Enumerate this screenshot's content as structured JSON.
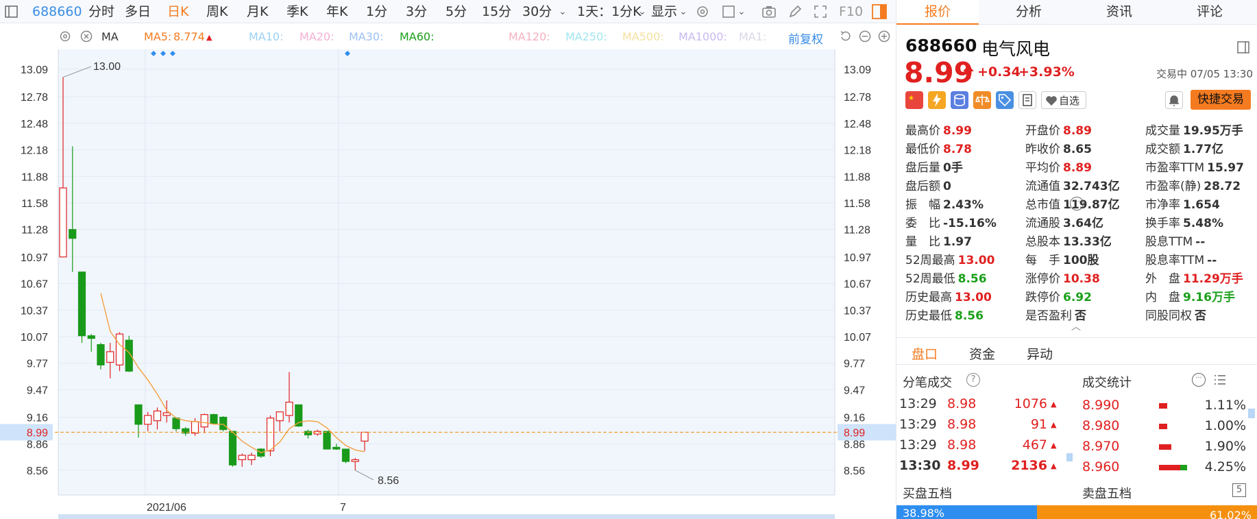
{
  "toolbar": {
    "code": "688660",
    "items": [
      "分时",
      "多日",
      "日K",
      "周K",
      "月K",
      "季K",
      "年K",
      "1分",
      "3分",
      "5分",
      "15分",
      "30分"
    ],
    "selected": "日K",
    "overlay": "1天：1分K",
    "display": "显示",
    "f10": "F10"
  },
  "indicators": {
    "ma": "MA",
    "ma5_label": "MA5:",
    "ma5_value": "8.774",
    "ma10": "MA10:",
    "ma20": "MA20:",
    "ma30": "MA30:",
    "ma60": "MA60:",
    "ma120": "MA120:",
    "ma250": "MA250:",
    "ma500": "MA500:",
    "ma1000": "MA1000:",
    "ma1": "MA1:",
    "adjust": "前复权"
  },
  "chart_data": {
    "type": "candlestick",
    "y_ticks": [
      "13.09",
      "12.78",
      "12.48",
      "12.18",
      "11.88",
      "11.58",
      "11.28",
      "10.97",
      "10.67",
      "10.37",
      "10.07",
      "9.77",
      "9.47",
      "9.16",
      "8.86",
      "8.56"
    ],
    "x_labels": [
      "2021/06",
      "7"
    ],
    "current_price": "8.99",
    "max_label": "13.00",
    "min_label": "8.56",
    "ylim": [
      8.42,
      13.15
    ],
    "candles": [
      {
        "o": 10.97,
        "h": 13.0,
        "l": 10.97,
        "c": 11.75
      },
      {
        "o": 11.28,
        "h": 12.22,
        "l": 10.8,
        "c": 11.18
      },
      {
        "o": 10.8,
        "h": 10.8,
        "l": 10.0,
        "c": 10.08
      },
      {
        "o": 10.08,
        "h": 10.1,
        "l": 9.9,
        "c": 10.05
      },
      {
        "o": 9.98,
        "h": 10.0,
        "l": 9.7,
        "c": 9.75
      },
      {
        "o": 9.78,
        "h": 10.0,
        "l": 9.6,
        "c": 9.9
      },
      {
        "o": 9.75,
        "h": 10.12,
        "l": 9.68,
        "c": 10.1
      },
      {
        "o": 10.03,
        "h": 10.08,
        "l": 9.67,
        "c": 9.68
      },
      {
        "o": 9.3,
        "h": 9.3,
        "l": 8.93,
        "c": 9.08
      },
      {
        "o": 9.08,
        "h": 9.22,
        "l": 9.0,
        "c": 9.18
      },
      {
        "o": 9.12,
        "h": 9.27,
        "l": 9.02,
        "c": 9.23
      },
      {
        "o": 9.18,
        "h": 9.35,
        "l": 9.1,
        "c": 9.21
      },
      {
        "o": 9.15,
        "h": 9.16,
        "l": 9.0,
        "c": 9.03
      },
      {
        "o": 9.03,
        "h": 9.05,
        "l": 8.95,
        "c": 8.98
      },
      {
        "o": 8.98,
        "h": 9.15,
        "l": 8.95,
        "c": 9.11
      },
      {
        "o": 9.05,
        "h": 9.2,
        "l": 8.98,
        "c": 9.19
      },
      {
        "o": 9.19,
        "h": 9.2,
        "l": 9.08,
        "c": 9.09
      },
      {
        "o": 9.16,
        "h": 9.17,
        "l": 9.0,
        "c": 9.02
      },
      {
        "o": 9.0,
        "h": 9.0,
        "l": 8.6,
        "c": 8.62
      },
      {
        "o": 8.68,
        "h": 8.75,
        "l": 8.6,
        "c": 8.73
      },
      {
        "o": 8.68,
        "h": 8.76,
        "l": 8.62,
        "c": 8.73
      },
      {
        "o": 8.8,
        "h": 8.81,
        "l": 8.7,
        "c": 8.72
      },
      {
        "o": 8.78,
        "h": 9.18,
        "l": 8.72,
        "c": 9.15
      },
      {
        "o": 9.12,
        "h": 9.22,
        "l": 9.0,
        "c": 9.22
      },
      {
        "o": 9.18,
        "h": 9.67,
        "l": 9.1,
        "c": 9.33
      },
      {
        "o": 9.3,
        "h": 9.3,
        "l": 9.05,
        "c": 9.06
      },
      {
        "o": 9.0,
        "h": 9.02,
        "l": 8.92,
        "c": 8.96
      },
      {
        "o": 8.97,
        "h": 9.02,
        "l": 8.95,
        "c": 9.0
      },
      {
        "o": 9.0,
        "h": 9.0,
        "l": 8.8,
        "c": 8.8
      },
      {
        "o": 8.82,
        "h": 8.86,
        "l": 8.79,
        "c": 8.8
      },
      {
        "o": 8.8,
        "h": 8.8,
        "l": 8.64,
        "c": 8.66
      },
      {
        "o": 8.66,
        "h": 8.7,
        "l": 8.56,
        "c": 8.68
      },
      {
        "o": 8.89,
        "h": 8.99,
        "l": 8.78,
        "c": 8.99
      }
    ],
    "ma5": [
      null,
      null,
      null,
      null,
      10.56,
      10.13,
      9.98,
      9.89,
      9.72,
      9.58,
      9.42,
      9.24,
      9.15,
      9.12,
      9.11,
      9.1,
      9.08,
      9.08,
      8.99,
      8.89,
      8.82,
      8.76,
      8.79,
      8.88,
      9.03,
      9.1,
      9.12,
      9.11,
      9.04,
      8.93,
      8.84,
      8.79,
      8.77
    ]
  },
  "panel": {
    "tabs": [
      "报价",
      "分析",
      "资讯",
      "评论"
    ],
    "code": "688660",
    "name": "电气风电",
    "price": "8.99",
    "change": "+0.34",
    "change_pct": "+3.93%",
    "status": "交易中 07/05 13:30",
    "watch": "自选",
    "quick_trade": "快捷交易",
    "quotes": [
      [
        [
          "最高价",
          "8.99",
          "red"
        ],
        [
          "开盘价",
          "8.89",
          "red"
        ],
        [
          "成交量",
          "19.95万手",
          "dark"
        ]
      ],
      [
        [
          "最低价",
          "8.78",
          "red"
        ],
        [
          "昨收价",
          "8.65",
          "dark"
        ],
        [
          "成交额",
          "1.77亿",
          "dark"
        ]
      ],
      [
        [
          "盘后量",
          "0手",
          "dark"
        ],
        [
          "平均价",
          "8.89",
          "red"
        ],
        [
          "市盈率TTM",
          "15.97",
          "dark"
        ]
      ],
      [
        [
          "盘后额",
          "0",
          "dark"
        ],
        [
          "流通值",
          "32.743亿",
          "dark"
        ],
        [
          "市盈率(静)",
          "28.72",
          "dark"
        ]
      ],
      [
        [
          "振　幅",
          "2.43%",
          "dark"
        ],
        [
          "总市值",
          "119.87亿",
          "dark"
        ],
        [
          "市净率",
          "1.654",
          "dark"
        ]
      ],
      [
        [
          "委　比",
          "-15.16%",
          "dark"
        ],
        [
          "流通股",
          "3.64亿",
          "dark"
        ],
        [
          "换手率",
          "5.48%",
          "dark"
        ]
      ],
      [
        [
          "量　比",
          "1.97",
          "dark"
        ],
        [
          "总股本",
          "13.33亿",
          "dark"
        ],
        [
          "股息TTM",
          "--",
          "dark"
        ]
      ],
      [
        [
          "52周最高",
          "13.00",
          "red"
        ],
        [
          "每　手",
          "100股",
          "dark"
        ],
        [
          "股息率TTM",
          "--",
          "dark"
        ]
      ],
      [
        [
          "52周最低",
          "8.56",
          "green"
        ],
        [
          "涨停价",
          "10.38",
          "red"
        ],
        [
          "外　盘",
          "11.29万手",
          "red"
        ]
      ],
      [
        [
          "历史最高",
          "13.00",
          "red"
        ],
        [
          "跌停价",
          "6.92",
          "green"
        ],
        [
          "内　盘",
          "9.16万手",
          "green"
        ]
      ],
      [
        [
          "历史最低",
          "8.56",
          "green"
        ],
        [
          "是否盈利",
          "否",
          "dark"
        ],
        [
          "同股同权",
          "否",
          "dark"
        ]
      ]
    ],
    "subtabs": [
      "盘口",
      "资金",
      "异动"
    ],
    "ticks_title": "分笔成交",
    "stats_title": "成交统计",
    "ticks": [
      {
        "time": "13:29",
        "price": "8.98",
        "vol": "1076"
      },
      {
        "time": "13:29",
        "price": "8.98",
        "vol": "91"
      },
      {
        "time": "13:29",
        "price": "8.98",
        "vol": "467"
      },
      {
        "time": "13:30",
        "price": "8.99",
        "vol": "2136"
      }
    ],
    "stats": [
      {
        "price": "8.990",
        "pct": "1.11%",
        "share": 0.11
      },
      {
        "price": "8.980",
        "pct": "1.00%",
        "share": 0.1
      },
      {
        "price": "8.970",
        "pct": "1.90%",
        "share": 0.19
      },
      {
        "price": "8.960",
        "pct": "4.25%",
        "share": 0.43
      }
    ],
    "buy5_title": "买盘五档",
    "sell5_title": "卖盘五档",
    "buy_pct": "38.98%",
    "sell_pct": "61.02%",
    "buy_ratio": 0.3898
  },
  "colors": {
    "up": "#e02020",
    "down": "#1a9a1a",
    "accent": "#f47b20",
    "ma5": "#f3a040",
    "blue": "#3a8ee6"
  }
}
